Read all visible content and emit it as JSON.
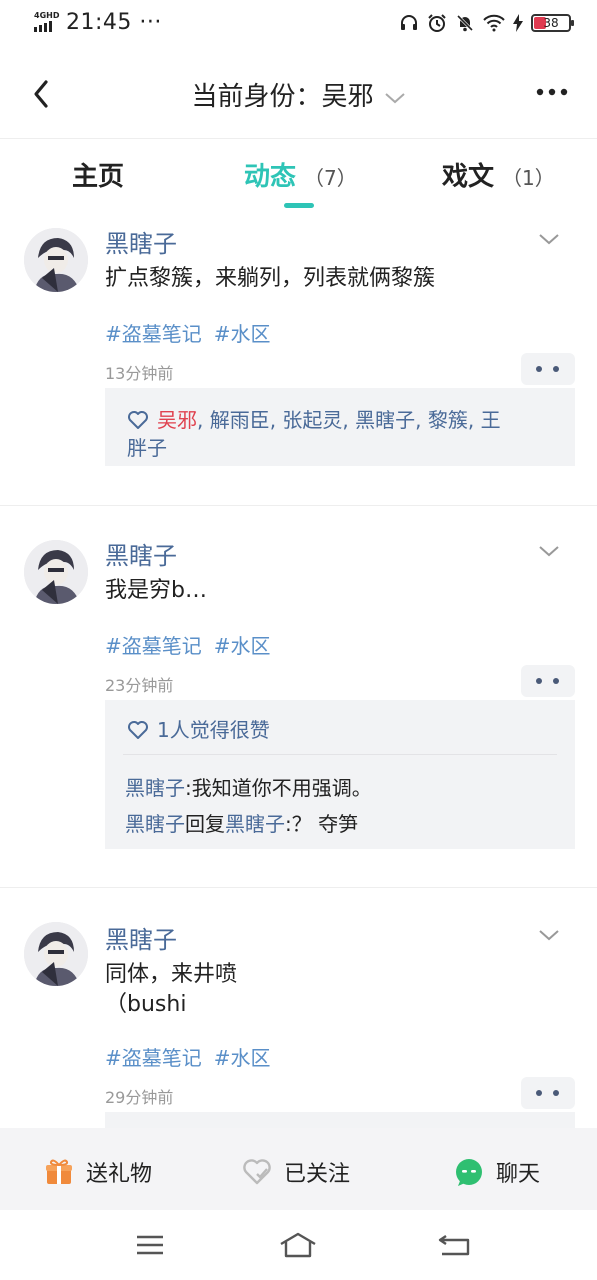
{
  "status_bar": {
    "network": "4GHD",
    "time": "21:45 ···",
    "battery": "38"
  },
  "header": {
    "title": "当前身份：吴邪",
    "back_icon": "chevron-left-icon",
    "more_icon": "more-dots-icon"
  },
  "tabs": [
    {
      "label": "主页",
      "count": ""
    },
    {
      "label": "动态",
      "count": "（7）"
    },
    {
      "label": "戏文",
      "count": "（1）"
    }
  ],
  "accent_color": "#2ec4b6",
  "posts": [
    {
      "author": "黑瞎子",
      "text_line1": "扩点黎簇，来躺列，列表就俩黎簇",
      "text_line2": "",
      "tags": [
        "#盗墓笔记",
        "#水区"
      ],
      "time": "13分钟前",
      "likes_first": "吴邪",
      "likes_rest": ", 解雨臣, 张起灵, 黑瞎子, 黎簇, 王",
      "likes_line2": "胖子"
    },
    {
      "author": "黑瞎子",
      "text_line1": "我是穷b…",
      "tags": [
        "#盗墓笔记",
        "#水区"
      ],
      "time": "23分钟前",
      "likes_summary": "1人觉得很赞",
      "comments": [
        {
          "user": "黑瞎子",
          "connector": "",
          "reply_to": "",
          "text": ":我知道你不用强调。"
        },
        {
          "user": "黑瞎子",
          "connector": "回复",
          "reply_to": "黑瞎子",
          "text": ":？ 夺笋"
        }
      ]
    },
    {
      "author": "黑瞎子",
      "text_line1": "同体，来井喷",
      "text_line2": "（bushi",
      "tags": [
        "#盗墓笔记",
        "#水区"
      ],
      "time": "29分钟前"
    }
  ],
  "action_bar": {
    "gift": "送礼物",
    "follow": "已关注",
    "chat": "聊天"
  }
}
